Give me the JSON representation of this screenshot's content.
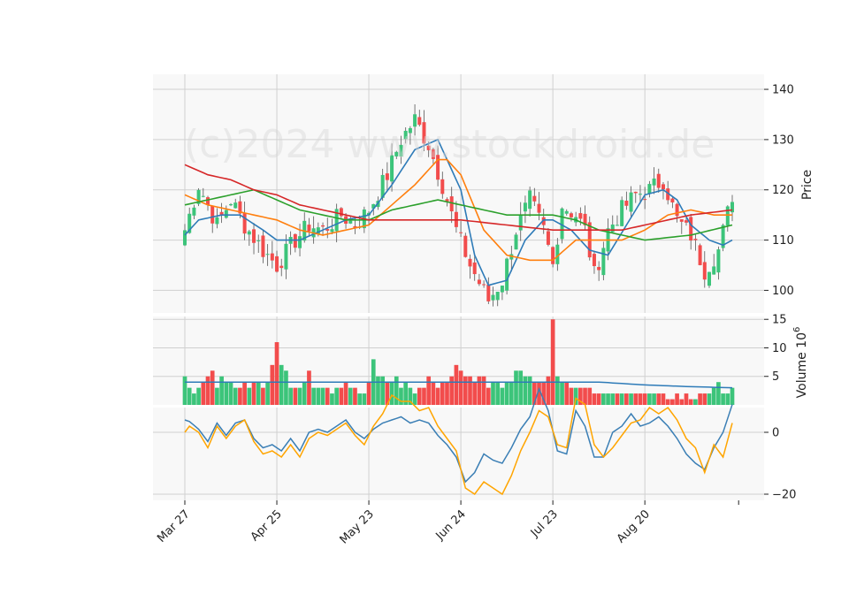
{
  "watermark": "(c)2024 www.stockdroid.de",
  "colors": {
    "up": "#3cc47a",
    "down": "#f24c4c",
    "ma_blue": "#2e7bb8",
    "ma_orange": "#ff7f0e",
    "ma_green": "#2ca02c",
    "ma_red": "#d62728",
    "vol_ma": "#2e7bb8",
    "osc_blue": "#3b7fb5",
    "osc_orange": "#ffa500",
    "grid": "#d0d0d0",
    "panel_bg": "#f8f8f8"
  },
  "chart_data": [
    {
      "type": "candlestick",
      "ylabel": "Price",
      "ylim": [
        95.5,
        143
      ],
      "yticks": [
        100,
        110,
        120,
        130,
        140
      ],
      "x_tick_labels": [
        "Mar 27",
        "Apr 25",
        "May 23",
        "Jun 24",
        "Jul 23",
        "Aug 20"
      ],
      "x_tick_index": [
        0,
        20,
        40,
        60,
        80,
        100
      ],
      "count": 120,
      "close_anchors": [
        [
          0,
          112
        ],
        [
          3,
          121
        ],
        [
          7,
          113
        ],
        [
          10,
          118
        ],
        [
          13,
          113
        ],
        [
          17,
          108
        ],
        [
          20,
          105
        ],
        [
          24,
          110
        ],
        [
          27,
          113
        ],
        [
          30,
          112
        ],
        [
          34,
          115
        ],
        [
          37,
          113
        ],
        [
          40,
          116
        ],
        [
          44,
          123
        ],
        [
          47,
          130
        ],
        [
          50,
          134
        ],
        [
          53,
          129
        ],
        [
          56,
          121
        ],
        [
          59,
          112
        ],
        [
          62,
          105
        ],
        [
          66,
          98
        ],
        [
          69,
          102
        ],
        [
          72,
          112
        ],
        [
          75,
          118
        ],
        [
          78,
          112
        ],
        [
          80,
          105
        ],
        [
          82,
          117
        ],
        [
          85,
          115
        ],
        [
          87,
          112
        ],
        [
          89,
          103
        ],
        [
          92,
          112
        ],
        [
          95,
          116
        ],
        [
          98,
          119
        ],
        [
          101,
          120
        ],
        [
          104,
          122
        ],
        [
          107,
          114
        ],
        [
          110,
          111
        ],
        [
          113,
          104
        ],
        [
          116,
          108
        ],
        [
          119,
          119
        ]
      ],
      "series": [
        {
          "name": "",
          "color_key": "ma_blue",
          "anchors": [
            [
              0,
              111
            ],
            [
              3,
              114
            ],
            [
              8,
              115
            ],
            [
              12,
              115
            ],
            [
              17,
              112
            ],
            [
              20,
              110
            ],
            [
              25,
              110
            ],
            [
              30,
              112
            ],
            [
              35,
              114
            ],
            [
              40,
              115
            ],
            [
              45,
              121
            ],
            [
              50,
              128
            ],
            [
              55,
              130
            ],
            [
              60,
              120
            ],
            [
              63,
              107
            ],
            [
              66,
              101
            ],
            [
              70,
              102
            ],
            [
              74,
              110
            ],
            [
              78,
              114
            ],
            [
              80,
              114
            ],
            [
              84,
              112
            ],
            [
              88,
              108
            ],
            [
              92,
              107
            ],
            [
              96,
              113
            ],
            [
              100,
              119
            ],
            [
              104,
              120
            ],
            [
              107,
              118
            ],
            [
              110,
              113
            ],
            [
              114,
              110
            ],
            [
              117,
              109
            ],
            [
              119,
              110
            ]
          ]
        },
        {
          "name": "",
          "color_key": "ma_orange",
          "anchors": [
            [
              0,
              119
            ],
            [
              5,
              117
            ],
            [
              10,
              116
            ],
            [
              15,
              115
            ],
            [
              20,
              114
            ],
            [
              25,
              112
            ],
            [
              30,
              111
            ],
            [
              35,
              112
            ],
            [
              40,
              113
            ],
            [
              45,
              117
            ],
            [
              50,
              121
            ],
            [
              55,
              126
            ],
            [
              57,
              126
            ],
            [
              60,
              123
            ],
            [
              65,
              112
            ],
            [
              70,
              107
            ],
            [
              75,
              106
            ],
            [
              80,
              106
            ],
            [
              85,
              110
            ],
            [
              90,
              110
            ],
            [
              95,
              110
            ],
            [
              100,
              112
            ],
            [
              105,
              115
            ],
            [
              110,
              116
            ],
            [
              115,
              115
            ],
            [
              119,
              115
            ]
          ]
        },
        {
          "name": "",
          "color_key": "ma_green",
          "anchors": [
            [
              0,
              117
            ],
            [
              5,
              118
            ],
            [
              10,
              119
            ],
            [
              15,
              120
            ],
            [
              20,
              118
            ],
            [
              25,
              116
            ],
            [
              30,
              115
            ],
            [
              35,
              114
            ],
            [
              40,
              114
            ],
            [
              45,
              116
            ],
            [
              50,
              117
            ],
            [
              55,
              118
            ],
            [
              60,
              117
            ],
            [
              70,
              115
            ],
            [
              80,
              115
            ],
            [
              85,
              114
            ],
            [
              90,
              112
            ],
            [
              95,
              111
            ],
            [
              100,
              110
            ],
            [
              110,
              111
            ],
            [
              119,
              113
            ]
          ]
        },
        {
          "name": "",
          "color_key": "ma_red",
          "anchors": [
            [
              0,
              125
            ],
            [
              5,
              123
            ],
            [
              10,
              122
            ],
            [
              15,
              120
            ],
            [
              20,
              119
            ],
            [
              25,
              117
            ],
            [
              30,
              116
            ],
            [
              35,
              115
            ],
            [
              40,
              114
            ],
            [
              50,
              114
            ],
            [
              55,
              114
            ],
            [
              60,
              114
            ],
            [
              70,
              113
            ],
            [
              80,
              112
            ],
            [
              90,
              112
            ],
            [
              95,
              112
            ],
            [
              100,
              113
            ],
            [
              105,
              114
            ],
            [
              110,
              115
            ],
            [
              119,
              116
            ]
          ]
        }
      ]
    },
    {
      "type": "bar",
      "ylabel": "Volume",
      "ylabel_exp": "6",
      "ylim": [
        0,
        15.5
      ],
      "yticks": [
        5,
        10,
        15
      ],
      "volume_values": [
        5,
        3,
        2,
        3,
        4,
        5,
        6,
        3,
        5,
        4,
        4,
        3,
        3,
        4,
        3,
        4,
        4,
        3,
        4,
        7,
        11,
        7,
        6,
        3,
        3,
        3,
        4,
        6,
        3,
        3,
        3,
        3,
        2,
        3,
        3,
        4,
        3,
        3,
        2,
        2,
        4,
        8,
        5,
        5,
        4,
        4,
        5,
        3,
        4,
        3,
        2,
        3,
        3,
        5,
        4,
        3,
        4,
        4,
        5,
        7,
        6,
        5,
        5,
        4,
        5,
        5,
        3,
        4,
        4,
        3,
        4,
        4,
        6,
        6,
        5,
        5,
        4,
        4,
        4,
        5,
        15,
        5,
        4,
        4,
        3,
        3,
        3,
        3,
        3,
        2,
        2,
        2,
        2,
        2,
        2,
        2,
        2,
        2,
        2,
        2,
        2,
        2,
        2,
        2,
        2,
        1,
        1,
        2,
        1,
        2,
        1,
        1,
        2,
        2,
        2,
        3,
        4,
        2,
        2,
        3
      ],
      "vol_ma_anchors": [
        [
          0,
          4
        ],
        [
          20,
          4
        ],
        [
          40,
          4
        ],
        [
          60,
          4
        ],
        [
          80,
          4
        ],
        [
          90,
          4
        ],
        [
          100,
          3.5
        ],
        [
          110,
          3.2
        ],
        [
          119,
          3
        ]
      ]
    },
    {
      "type": "line",
      "ylabel": "",
      "ylim": [
        -22,
        8
      ],
      "yticks": [
        -20,
        0
      ],
      "series": [
        {
          "name": "",
          "color_key": "osc_blue",
          "anchors": [
            [
              0,
              4
            ],
            [
              1,
              3.5
            ],
            [
              3,
              1
            ],
            [
              5,
              -3
            ],
            [
              7,
              3
            ],
            [
              9,
              -1
            ],
            [
              11,
              3
            ],
            [
              13,
              4
            ],
            [
              15,
              -2
            ],
            [
              17,
              -5
            ],
            [
              19,
              -4
            ],
            [
              21,
              -6
            ],
            [
              23,
              -2
            ],
            [
              25,
              -6
            ],
            [
              27,
              0
            ],
            [
              29,
              1
            ],
            [
              31,
              0
            ],
            [
              33,
              2
            ],
            [
              35,
              4
            ],
            [
              37,
              0
            ],
            [
              39,
              -2
            ],
            [
              41,
              1
            ],
            [
              43,
              3
            ],
            [
              45,
              4
            ],
            [
              47,
              5
            ],
            [
              49,
              3
            ],
            [
              51,
              4
            ],
            [
              53,
              3
            ],
            [
              55,
              -1
            ],
            [
              57,
              -4
            ],
            [
              59,
              -8
            ],
            [
              61,
              -16
            ],
            [
              63,
              -13
            ],
            [
              65,
              -7
            ],
            [
              67,
              -9
            ],
            [
              69,
              -10
            ],
            [
              71,
              -5
            ],
            [
              73,
              1
            ],
            [
              75,
              5
            ],
            [
              77,
              14
            ],
            [
              79,
              7
            ],
            [
              81,
              -6
            ],
            [
              83,
              -7
            ],
            [
              85,
              7
            ],
            [
              87,
              2
            ],
            [
              89,
              -8
            ],
            [
              91,
              -8
            ],
            [
              93,
              0
            ],
            [
              95,
              2
            ],
            [
              97,
              6
            ],
            [
              99,
              2
            ],
            [
              101,
              3
            ],
            [
              103,
              5
            ],
            [
              105,
              2
            ],
            [
              107,
              -2
            ],
            [
              109,
              -7
            ],
            [
              111,
              -10
            ],
            [
              113,
              -12
            ],
            [
              115,
              -5
            ],
            [
              117,
              0
            ],
            [
              119,
              9
            ]
          ]
        },
        {
          "name": "",
          "color_key": "osc_orange",
          "anchors": [
            [
              0,
              0
            ],
            [
              1,
              2
            ],
            [
              3,
              0
            ],
            [
              5,
              -5
            ],
            [
              7,
              2
            ],
            [
              9,
              -2
            ],
            [
              11,
              2
            ],
            [
              13,
              4
            ],
            [
              15,
              -3
            ],
            [
              17,
              -7
            ],
            [
              19,
              -6
            ],
            [
              21,
              -8
            ],
            [
              23,
              -4
            ],
            [
              25,
              -8
            ],
            [
              27,
              -2
            ],
            [
              29,
              0
            ],
            [
              31,
              -1
            ],
            [
              33,
              1
            ],
            [
              35,
              3
            ],
            [
              37,
              -1
            ],
            [
              39,
              -4
            ],
            [
              41,
              2
            ],
            [
              43,
              6
            ],
            [
              45,
              12
            ],
            [
              47,
              10
            ],
            [
              49,
              10
            ],
            [
              51,
              7
            ],
            [
              53,
              8
            ],
            [
              55,
              2
            ],
            [
              57,
              -2
            ],
            [
              59,
              -6
            ],
            [
              61,
              -18
            ],
            [
              63,
              -20
            ],
            [
              65,
              -16
            ],
            [
              67,
              -18
            ],
            [
              69,
              -20
            ],
            [
              71,
              -14
            ],
            [
              73,
              -6
            ],
            [
              75,
              0
            ],
            [
              77,
              7
            ],
            [
              79,
              5
            ],
            [
              81,
              -4
            ],
            [
              83,
              -5
            ],
            [
              85,
              11
            ],
            [
              87,
              9
            ],
            [
              89,
              -4
            ],
            [
              91,
              -8
            ],
            [
              93,
              -5
            ],
            [
              95,
              -1
            ],
            [
              97,
              3
            ],
            [
              99,
              4
            ],
            [
              101,
              8
            ],
            [
              103,
              6
            ],
            [
              105,
              8
            ],
            [
              107,
              4
            ],
            [
              109,
              -2
            ],
            [
              111,
              -5
            ],
            [
              113,
              -13
            ],
            [
              115,
              -4
            ],
            [
              117,
              -8
            ],
            [
              119,
              3
            ]
          ]
        }
      ]
    }
  ]
}
